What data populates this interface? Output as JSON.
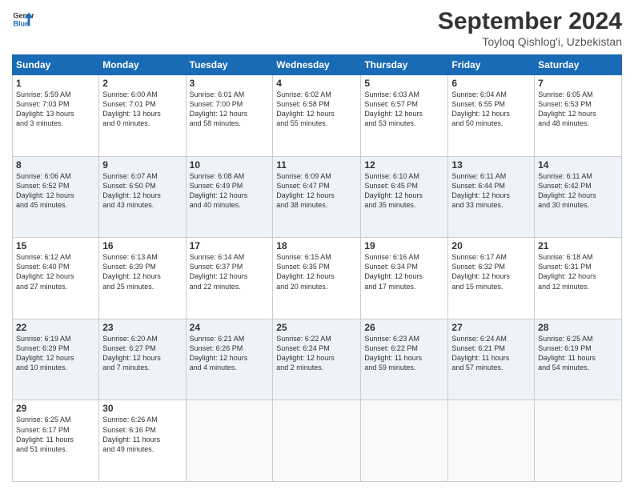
{
  "logo": {
    "line1": "General",
    "line2": "Blue"
  },
  "title": "September 2024",
  "subtitle": "Toyloq Qishlog'i, Uzbekistan",
  "weekdays": [
    "Sunday",
    "Monday",
    "Tuesday",
    "Wednesday",
    "Thursday",
    "Friday",
    "Saturday"
  ],
  "weeks": [
    [
      {
        "day": "1",
        "info": "Sunrise: 5:59 AM\nSunset: 7:03 PM\nDaylight: 13 hours\nand 3 minutes."
      },
      {
        "day": "2",
        "info": "Sunrise: 6:00 AM\nSunset: 7:01 PM\nDaylight: 13 hours\nand 0 minutes."
      },
      {
        "day": "3",
        "info": "Sunrise: 6:01 AM\nSunset: 7:00 PM\nDaylight: 12 hours\nand 58 minutes."
      },
      {
        "day": "4",
        "info": "Sunrise: 6:02 AM\nSunset: 6:58 PM\nDaylight: 12 hours\nand 55 minutes."
      },
      {
        "day": "5",
        "info": "Sunrise: 6:03 AM\nSunset: 6:57 PM\nDaylight: 12 hours\nand 53 minutes."
      },
      {
        "day": "6",
        "info": "Sunrise: 6:04 AM\nSunset: 6:55 PM\nDaylight: 12 hours\nand 50 minutes."
      },
      {
        "day": "7",
        "info": "Sunrise: 6:05 AM\nSunset: 6:53 PM\nDaylight: 12 hours\nand 48 minutes."
      }
    ],
    [
      {
        "day": "8",
        "info": "Sunrise: 6:06 AM\nSunset: 6:52 PM\nDaylight: 12 hours\nand 45 minutes."
      },
      {
        "day": "9",
        "info": "Sunrise: 6:07 AM\nSunset: 6:50 PM\nDaylight: 12 hours\nand 43 minutes."
      },
      {
        "day": "10",
        "info": "Sunrise: 6:08 AM\nSunset: 6:49 PM\nDaylight: 12 hours\nand 40 minutes."
      },
      {
        "day": "11",
        "info": "Sunrise: 6:09 AM\nSunset: 6:47 PM\nDaylight: 12 hours\nand 38 minutes."
      },
      {
        "day": "12",
        "info": "Sunrise: 6:10 AM\nSunset: 6:45 PM\nDaylight: 12 hours\nand 35 minutes."
      },
      {
        "day": "13",
        "info": "Sunrise: 6:11 AM\nSunset: 6:44 PM\nDaylight: 12 hours\nand 33 minutes."
      },
      {
        "day": "14",
        "info": "Sunrise: 6:11 AM\nSunset: 6:42 PM\nDaylight: 12 hours\nand 30 minutes."
      }
    ],
    [
      {
        "day": "15",
        "info": "Sunrise: 6:12 AM\nSunset: 6:40 PM\nDaylight: 12 hours\nand 27 minutes."
      },
      {
        "day": "16",
        "info": "Sunrise: 6:13 AM\nSunset: 6:39 PM\nDaylight: 12 hours\nand 25 minutes."
      },
      {
        "day": "17",
        "info": "Sunrise: 6:14 AM\nSunset: 6:37 PM\nDaylight: 12 hours\nand 22 minutes."
      },
      {
        "day": "18",
        "info": "Sunrise: 6:15 AM\nSunset: 6:35 PM\nDaylight: 12 hours\nand 20 minutes."
      },
      {
        "day": "19",
        "info": "Sunrise: 6:16 AM\nSunset: 6:34 PM\nDaylight: 12 hours\nand 17 minutes."
      },
      {
        "day": "20",
        "info": "Sunrise: 6:17 AM\nSunset: 6:32 PM\nDaylight: 12 hours\nand 15 minutes."
      },
      {
        "day": "21",
        "info": "Sunrise: 6:18 AM\nSunset: 6:31 PM\nDaylight: 12 hours\nand 12 minutes."
      }
    ],
    [
      {
        "day": "22",
        "info": "Sunrise: 6:19 AM\nSunset: 6:29 PM\nDaylight: 12 hours\nand 10 minutes."
      },
      {
        "day": "23",
        "info": "Sunrise: 6:20 AM\nSunset: 6:27 PM\nDaylight: 12 hours\nand 7 minutes."
      },
      {
        "day": "24",
        "info": "Sunrise: 6:21 AM\nSunset: 6:26 PM\nDaylight: 12 hours\nand 4 minutes."
      },
      {
        "day": "25",
        "info": "Sunrise: 6:22 AM\nSunset: 6:24 PM\nDaylight: 12 hours\nand 2 minutes."
      },
      {
        "day": "26",
        "info": "Sunrise: 6:23 AM\nSunset: 6:22 PM\nDaylight: 11 hours\nand 59 minutes."
      },
      {
        "day": "27",
        "info": "Sunrise: 6:24 AM\nSunset: 6:21 PM\nDaylight: 11 hours\nand 57 minutes."
      },
      {
        "day": "28",
        "info": "Sunrise: 6:25 AM\nSunset: 6:19 PM\nDaylight: 11 hours\nand 54 minutes."
      }
    ],
    [
      {
        "day": "29",
        "info": "Sunrise: 6:25 AM\nSunset: 6:17 PM\nDaylight: 11 hours\nand 51 minutes."
      },
      {
        "day": "30",
        "info": "Sunrise: 6:26 AM\nSunset: 6:16 PM\nDaylight: 11 hours\nand 49 minutes."
      },
      null,
      null,
      null,
      null,
      null
    ]
  ]
}
